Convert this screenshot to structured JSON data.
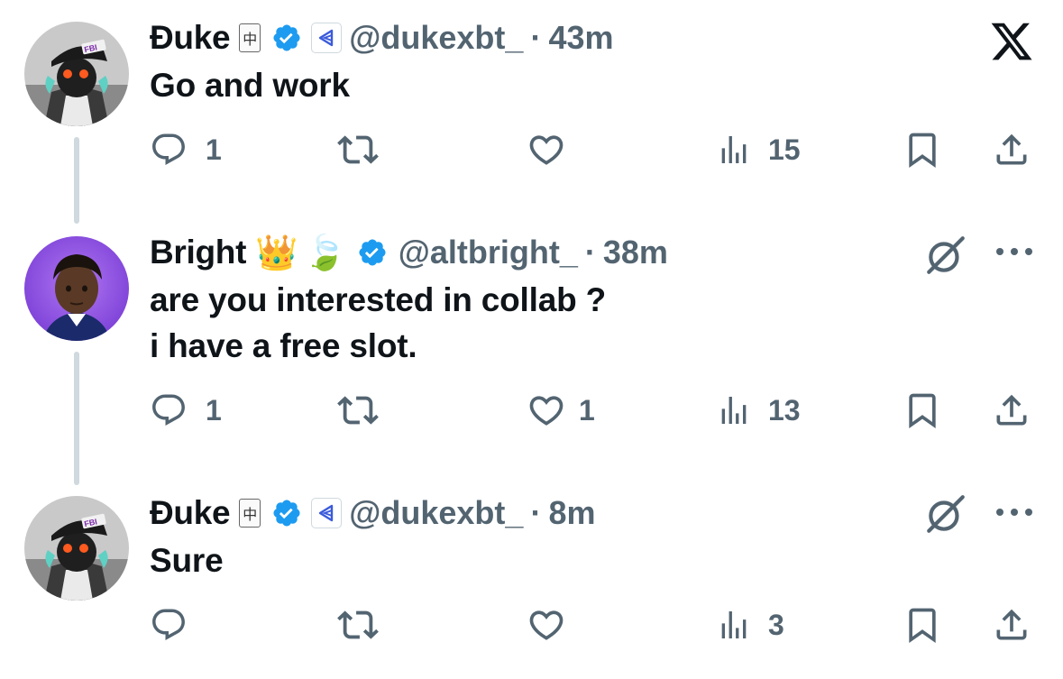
{
  "tweets": [
    {
      "name": "Đuke",
      "mahjong": "中",
      "handle": "@dukexbt_",
      "dot": "·",
      "time": "43m",
      "lines": [
        "Go and work"
      ],
      "stats": {
        "replies": "1",
        "retweets": "",
        "likes": "",
        "views": "15"
      }
    },
    {
      "name": "Bright",
      "emoji_1": "👑",
      "emoji_2": "🍃",
      "handle": "@altbright_",
      "dot": "·",
      "time": "38m",
      "lines": [
        "are you interested in collab ?",
        "i have a free slot."
      ],
      "stats": {
        "replies": "1",
        "retweets": "",
        "likes": "1",
        "views": "13"
      }
    },
    {
      "name": "Đuke",
      "mahjong": "中",
      "handle": "@dukexbt_",
      "dot": "·",
      "time": "8m",
      "lines": [
        "Sure"
      ],
      "stats": {
        "replies": "",
        "retweets": "",
        "likes": "",
        "views": "3"
      }
    }
  ],
  "avatar_labels": {
    "fbi_cap": "FBI"
  },
  "colors": {
    "text": "#0f1419",
    "muted": "#536471",
    "verified": "#1d9bf0",
    "thread_line": "#cfd9de",
    "affiliate": "#3b5bdb"
  },
  "icons": [
    "x-logo-icon",
    "reply-icon",
    "retweet-icon",
    "like-icon",
    "views-icon",
    "bookmark-icon",
    "share-icon",
    "grok-icon",
    "more-icon",
    "verified-icon"
  ]
}
